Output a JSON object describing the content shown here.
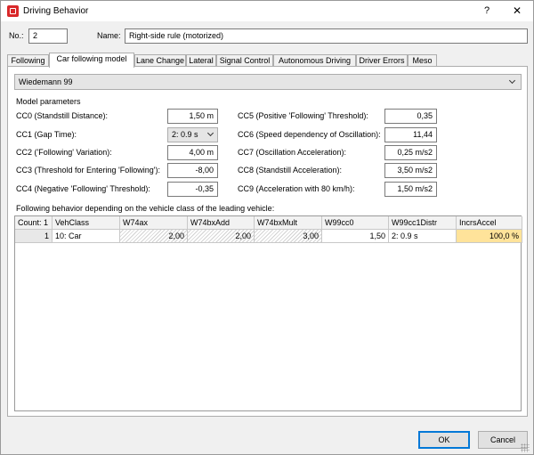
{
  "window": {
    "title": "Driving Behavior",
    "help_label": "?",
    "close_label": "✕",
    "icon": "app-icon"
  },
  "header": {
    "no_label": "No.:",
    "no_value": "2",
    "name_label": "Name:",
    "name_value": "Right-side rule (motorized)"
  },
  "tabs": [
    {
      "label": "Following"
    },
    {
      "label": "Car following model"
    },
    {
      "label": "Lane Change"
    },
    {
      "label": "Lateral"
    },
    {
      "label": "Signal Control"
    },
    {
      "label": "Autonomous Driving"
    },
    {
      "label": "Driver Errors"
    },
    {
      "label": "Meso"
    }
  ],
  "active_tab": "Car following model",
  "model": {
    "selected": "Wiedemann 99",
    "icon": "chevron-down-icon"
  },
  "params": {
    "section_label": "Model parameters",
    "left": [
      {
        "label": "CC0 (Standstill Distance):",
        "value": "1,50 m"
      },
      {
        "label": "CC1 (Gap Time):",
        "value": "2: 0.9 s"
      },
      {
        "label": "CC2 ('Following' Variation):",
        "value": "4,00 m"
      },
      {
        "label": "CC3 (Threshold for Entering 'Following'):",
        "value": "-8,00"
      },
      {
        "label": "CC4 (Negative 'Following' Threshold):",
        "value": "-0,35"
      }
    ],
    "right": [
      {
        "label": "CC5 (Positive 'Following' Threshold):",
        "value": "0,35"
      },
      {
        "label": "CC6 (Speed dependency of Oscillation):",
        "value": "11,44"
      },
      {
        "label": "CC7 (Oscillation Acceleration):",
        "value": "0,25 m/s2"
      },
      {
        "label": "CC8 (Standstill Acceleration):",
        "value": "3,50 m/s2"
      },
      {
        "label": "CC9 (Acceleration with 80 km/h):",
        "value": "1,50 m/s2"
      }
    ]
  },
  "table": {
    "caption": "Following behavior depending on the vehicle class of the leading vehicle:",
    "columns": [
      "Count: 1",
      "VehClass",
      "W74ax",
      "W74bxAdd",
      "W74bxMult",
      "W99cc0",
      "W99cc1Distr",
      "IncrsAccel"
    ],
    "rows": [
      [
        "1",
        "10: Car",
        "2,00",
        "2,00",
        "3,00",
        "1,50",
        "2: 0.9 s",
        "100,0 %"
      ]
    ],
    "highlight_color": "#ffe39a"
  },
  "buttons": {
    "ok": "OK",
    "cancel": "Cancel"
  }
}
